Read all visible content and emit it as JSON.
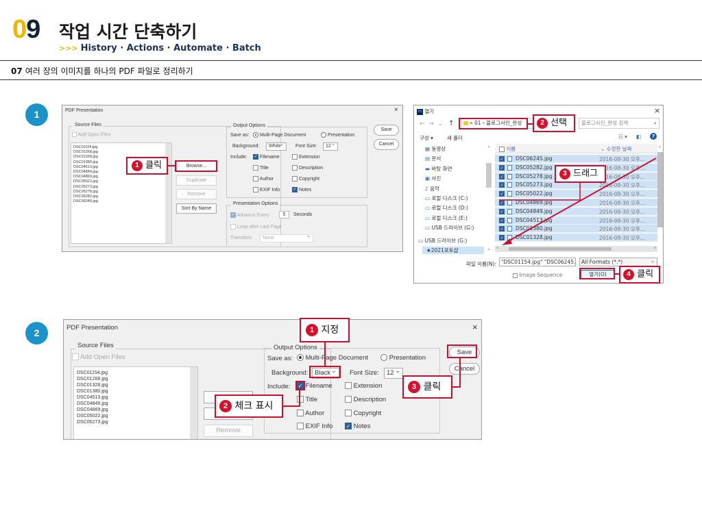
{
  "header": {
    "chapter_digit_a": "0",
    "chapter_digit_b": "9",
    "title": "작업 시간 단축하기",
    "sub_arrows": ">>>",
    "subtitle": "History · Actions · Automate · Batch",
    "section_num": "07",
    "section_title": "여러 장의 이미지를 하나의 PDF 파일로 정리하기"
  },
  "steps": [
    "1",
    "2"
  ],
  "colors": {
    "accent_yellow": "#f2b400",
    "navy": "#12223a",
    "step_blue": "#1b93c8",
    "callout_red": "#c8102e",
    "checkbox_blue": "#2f5f96"
  },
  "pdf1": {
    "title": "PDF Presentation",
    "close": "×",
    "source_files": "Source Files",
    "add_open_files": "Add Open Files",
    "files": [
      "DSC01154.jpg",
      "DSC01268.jpg",
      "DSC01328.jpg",
      "DSC01380.jpg",
      "DSC04513.jpg",
      "DSC04849.jpg",
      "DSC04869.jpg",
      "DSC05022.jpg",
      "DSC05273.jpg",
      "DSC05278.jpg",
      "DSC05282.jpg",
      "DSC06245.jpg"
    ],
    "browse": "Browse...",
    "duplicate": "Duplicate",
    "remove": "Remove",
    "sort_by_name": "Sort By Name",
    "output_options": "Output Options",
    "save_as": "Save as:",
    "multi_page": "Multi-Page Document",
    "presentation": "Presentation",
    "background": "Background:",
    "background_value": "White",
    "font_size": "Font Size:",
    "font_size_value": "12",
    "include": "Include:",
    "filename": "Filename",
    "extension": "Extension",
    "title_opt": "Title",
    "description": "Description",
    "author": "Author",
    "copyright": "Copyright",
    "exif": "EXIF Info",
    "notes": "Notes",
    "presentation_options": "Presentation Options",
    "advance_every": "Advance Every",
    "advance_value": "5",
    "seconds": "Seconds",
    "loop": "Loop after Last Page",
    "transition": "Transition:",
    "transition_value": "None",
    "save": "Save",
    "cancel": "Cancel",
    "callout_num": "1",
    "callout_text": "클릭"
  },
  "open_dialog": {
    "title": "열기",
    "close": "×",
    "path": "« 01  ›  블로그사진_완성",
    "search_placeholder": "블로그사진_완성 검색",
    "organize": "구성 ▾",
    "new_folder": "새 폴더",
    "nav": [
      "동영상",
      "문서",
      "바탕 화면",
      "사진",
      "음악",
      "로컬 디스크 (C:)",
      "로컬 디스크 (D:)",
      "로컬 디스크 (E:)",
      "USB 드라이브 (G:)",
      "USB 드라이브 (G:)",
      "★2021포토샵"
    ],
    "col_name": "이름",
    "col_date": "수정한 날짜",
    "files": [
      {
        "name": "DSC06245.jpg",
        "date": "2016-08-30 오후..."
      },
      {
        "name": "DSC05282.jpg",
        "date": "2016-08-30 오후..."
      },
      {
        "name": "DSC05278.jpg",
        "date": "2016-08-30 오후..."
      },
      {
        "name": "DSC05273.jpg",
        "date": "2016-08-30 오후..."
      },
      {
        "name": "DSC05022.jpg",
        "date": "2016-08-30 오후..."
      },
      {
        "name": "DSC04869.jpg",
        "date": "2016-08-30 오후..."
      },
      {
        "name": "DSC04849.jpg",
        "date": "2016-08-30 오후..."
      },
      {
        "name": "DSC04513.jpg",
        "date": "2016-08-30 오후..."
      },
      {
        "name": "DSC01380.jpg",
        "date": "2016-08-30 오후..."
      },
      {
        "name": "DSC01328.jpg",
        "date": "2016-08-30 오후..."
      }
    ],
    "filename_label": "파일 이름(N):",
    "filename_value": "\"DSC01154.jpg\" \"DSC06245...",
    "filetype": "All Formats (*.*)",
    "image_sequence": "Image Sequence",
    "open": "열기(O)",
    "callout2_num": "2",
    "callout2_text": "선택",
    "callout3_num": "3",
    "callout3_text": "드래그",
    "callout4_num": "4",
    "callout4_text": "클릭"
  },
  "pdf2": {
    "title": "PDF Presentation",
    "close": "×",
    "source_files": "Source Files",
    "add_open_files": "Add Open Files",
    "files": [
      "DSC01154.jpg",
      "DSC01268.jpg",
      "DSC01328.jpg",
      "DSC01380.jpg",
      "DSC04513.jpg",
      "DSC04849.jpg",
      "DSC04869.jpg",
      "DSC05022.jpg",
      "DSC05273.jpg"
    ],
    "remove": "Remove",
    "output_options": "Output Options",
    "save_as": "Save as:",
    "multi_page": "Multi-Page Document",
    "presentation": "Presentation",
    "background": "Background:",
    "background_value": "Black",
    "font_size": "Font Size:",
    "font_size_value": "12",
    "include": "Include:",
    "filename": "Filename",
    "extension": "Extension",
    "title_opt": "Title",
    "description": "Description",
    "author": "Author",
    "copyright": "Copyright",
    "exif": "EXIF Info",
    "notes": "Notes",
    "save": "Save",
    "cancel": "Cancel",
    "callout1_num": "1",
    "callout1_text": "지정",
    "callout2_num": "2",
    "callout2_text": "체크 표시",
    "callout3_num": "3",
    "callout3_text": "클릭"
  }
}
